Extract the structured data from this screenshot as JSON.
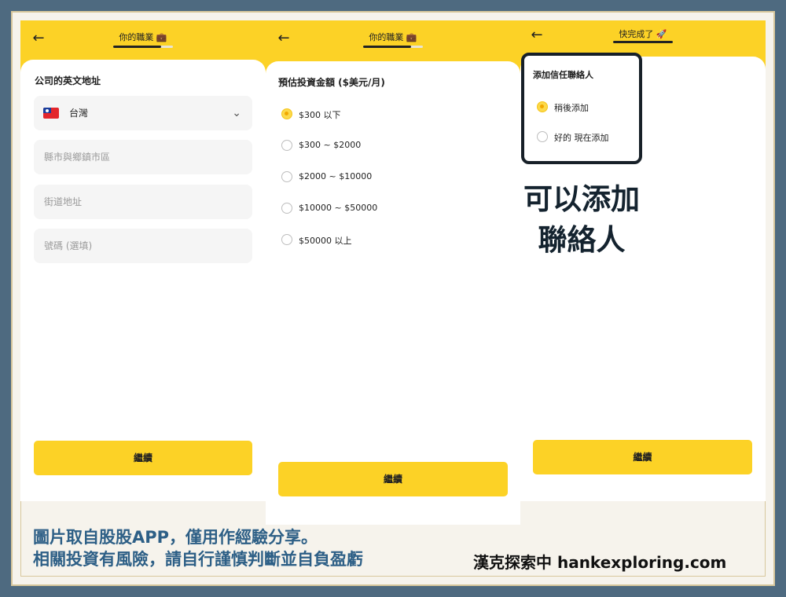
{
  "screen1": {
    "header_title": "你的職業 💼",
    "section_label": "公司的英文地址",
    "country": "台灣",
    "city_placeholder": "縣市與鄉鎮市區",
    "street_placeholder": "街道地址",
    "number_placeholder": "號碼 (選填)",
    "continue_label": "繼續"
  },
  "screen2": {
    "header_title": "你的職業 💼",
    "question": "預估投資金額 ($美元/月)",
    "options": [
      "$300 以下",
      "$300 ~ $2000",
      "$2000 ~ $10000",
      "$10000 ~ $50000",
      "$50000 以上"
    ],
    "selected_index": 0,
    "continue_label": "繼續"
  },
  "screen3": {
    "header_title": "快完成了 🚀",
    "question": "添加信任聯絡人",
    "options": [
      "稍後添加",
      "好的 現在添加"
    ],
    "selected_index": 0,
    "continue_label": "繼續"
  },
  "overlay": {
    "line1": "可以添加",
    "line2": "聯絡人"
  },
  "caption": {
    "line1": "圖片取自股股APP，僅用作經驗分享。",
    "line2": "相關投資有風險，請自行謹慎判斷並自負盈虧"
  },
  "credit": "漢克探索中 hankexploring.com",
  "colors": {
    "accent": "#fcd226",
    "border_blue": "#4e6a80",
    "caption": "#2d5f86"
  }
}
